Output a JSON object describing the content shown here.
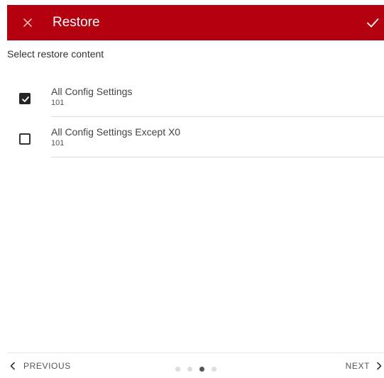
{
  "header": {
    "title": "Restore",
    "background_color": "#b5000f",
    "close_icon": "close-icon",
    "confirm_icon": "check-icon"
  },
  "subtitle": "Select restore content",
  "options": [
    {
      "label": "All Config Settings",
      "sublabel": "101",
      "checked": true
    },
    {
      "label": "All Config Settings Except X0",
      "sublabel": "101",
      "checked": false
    }
  ],
  "footer": {
    "previous_label": "PREVIOUS",
    "next_label": "NEXT",
    "page_indicator": {
      "total": 4,
      "current": 3
    }
  }
}
